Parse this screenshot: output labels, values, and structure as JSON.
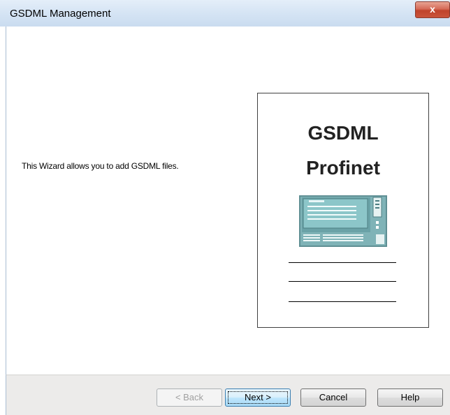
{
  "window": {
    "title": "GSDML Management",
    "close_label": "x"
  },
  "main": {
    "intro_text": "This Wizard allows you to add GSDML files."
  },
  "card": {
    "title_line1": "GSDML",
    "title_line2": "Profinet",
    "image_icon": "profinet-device-icon"
  },
  "buttons": {
    "back": "< Back",
    "next": "Next >",
    "cancel": "Cancel",
    "help": "Help"
  },
  "colors": {
    "titlebar": "#d5e4f4",
    "close_button": "#c9533a",
    "button_bar": "#ecebea",
    "device_body": "#7fb3b7"
  }
}
